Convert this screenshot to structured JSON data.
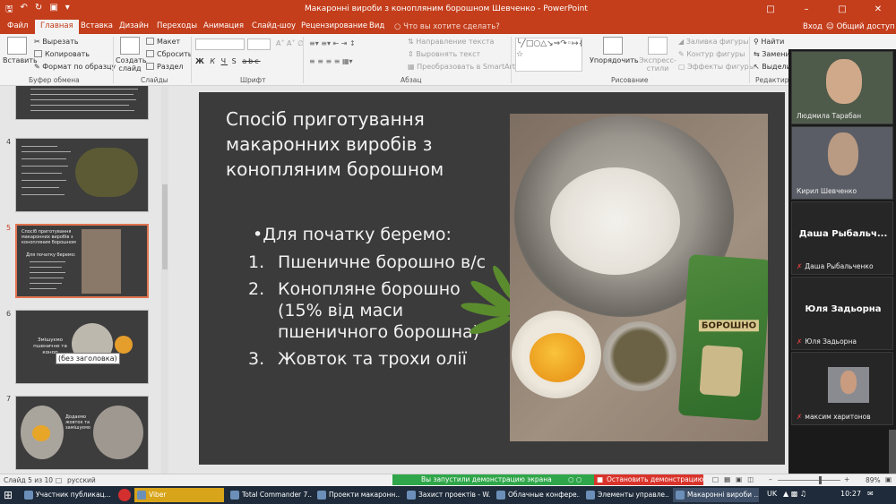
{
  "window": {
    "title": "Макаронні вироби з конопляним борошном Шевченко - PowerPoint"
  },
  "tabs": [
    {
      "label": "Файл",
      "active": false
    },
    {
      "label": "Главная",
      "active": true
    },
    {
      "label": "Вставка",
      "active": false
    },
    {
      "label": "Дизайн",
      "active": false
    },
    {
      "label": "Переходы",
      "active": false
    },
    {
      "label": "Анимация",
      "active": false
    },
    {
      "label": "Слайд-шоу",
      "active": false
    },
    {
      "label": "Рецензирование",
      "active": false
    },
    {
      "label": "Вид",
      "active": false
    }
  ],
  "tellme": "Что вы хотите сделать?",
  "account": {
    "login": "Вход",
    "share": "Общий доступ"
  },
  "ribbon": {
    "paste": "Вставить",
    "cut": "Вырезать",
    "copy": "Копировать",
    "format_painter": "Формат по образцу",
    "new_slide": "Создать слайд",
    "layout": "Макет",
    "reset": "Сбросить",
    "section": "Раздел",
    "text_direction": "Направление текста",
    "align_text": "Выровнять текст",
    "smartart": "Преобразовать в SmartArt",
    "arrange": "Упорядочить",
    "quick_styles": "Экспресс-стили",
    "shape_fill": "Заливка фигуры",
    "shape_outline": "Контур фигуры",
    "shape_effects": "Эффекты фигуры",
    "find": "Найти",
    "replace": "Заменить",
    "select": "Выделить",
    "groups": {
      "clipboard": "Буфер обмена",
      "slides": "Слайды",
      "font": "Шрифт",
      "paragraph": "Абзац",
      "drawing": "Рисование",
      "editing": "Редактирование"
    },
    "font_buttons": [
      "Ж",
      "К",
      "Ч",
      "S",
      "abc"
    ]
  },
  "thumbnails": [
    {
      "number": "4"
    },
    {
      "number": "5",
      "current": true,
      "title": "Спосіб приготування макаронних виробів з конопляним борошном",
      "bullet": "Для початку беремо:"
    },
    {
      "number": "6",
      "text": "Змішуємо пшеничне та коноп"
    },
    {
      "number": "7",
      "text": "Додаємо жовток та замішуємо"
    }
  ],
  "tooltip": "(без заголовка)",
  "slide": {
    "title": "Спосіб приготування макаронних виробів з конопляним борошном",
    "bullet": "Для початку беремо:",
    "items": [
      {
        "n": "1.",
        "text": "Пшеничне борошно в/с"
      },
      {
        "n": "2.",
        "text": "Конопляне борошно (15% від маси пшеничного борошна)"
      },
      {
        "n": "3.",
        "text": "Жовток та трохи олії"
      }
    ],
    "package_label": "БОРОШНО"
  },
  "participants": [
    {
      "name": "Людмила Тарабан",
      "video": true,
      "muted": false
    },
    {
      "name": "Кирил Шевченко",
      "video": true,
      "muted": false
    },
    {
      "name": "Даша Рыбальченко",
      "display": "Даша Рыбальч...",
      "video": false,
      "muted": true
    },
    {
      "name": "Юля Задьорна",
      "display": "Юля Задьорна",
      "video": false,
      "muted": true
    },
    {
      "name": "максим харитонов",
      "video": true,
      "muted": true
    }
  ],
  "status": {
    "slide": "Слайд 5 из 10",
    "language": "русский",
    "screen_share": "Вы запустили демонстрацию экрана",
    "stop_share": "Остановить демонстрацию",
    "zoom": "89%"
  },
  "taskbar": [
    {
      "label": "Участник публикац..."
    },
    {
      "label": "Viber",
      "style": "yellow"
    },
    {
      "label": "Total Commander 7..."
    },
    {
      "label": "Проекти макаронн..."
    },
    {
      "label": "Захист проектів - W..."
    },
    {
      "label": "Облачные конфере..."
    },
    {
      "label": "Элементы управле..."
    },
    {
      "label": "Макаронні вироби ...",
      "style": "active"
    }
  ],
  "tray": {
    "lang": "UK",
    "time": "10:27"
  },
  "colors": {
    "accent": "#c43e1c",
    "slide_bg": "#3b3b3b",
    "share_green": "#2fa649",
    "stop_red": "#d9342b"
  }
}
